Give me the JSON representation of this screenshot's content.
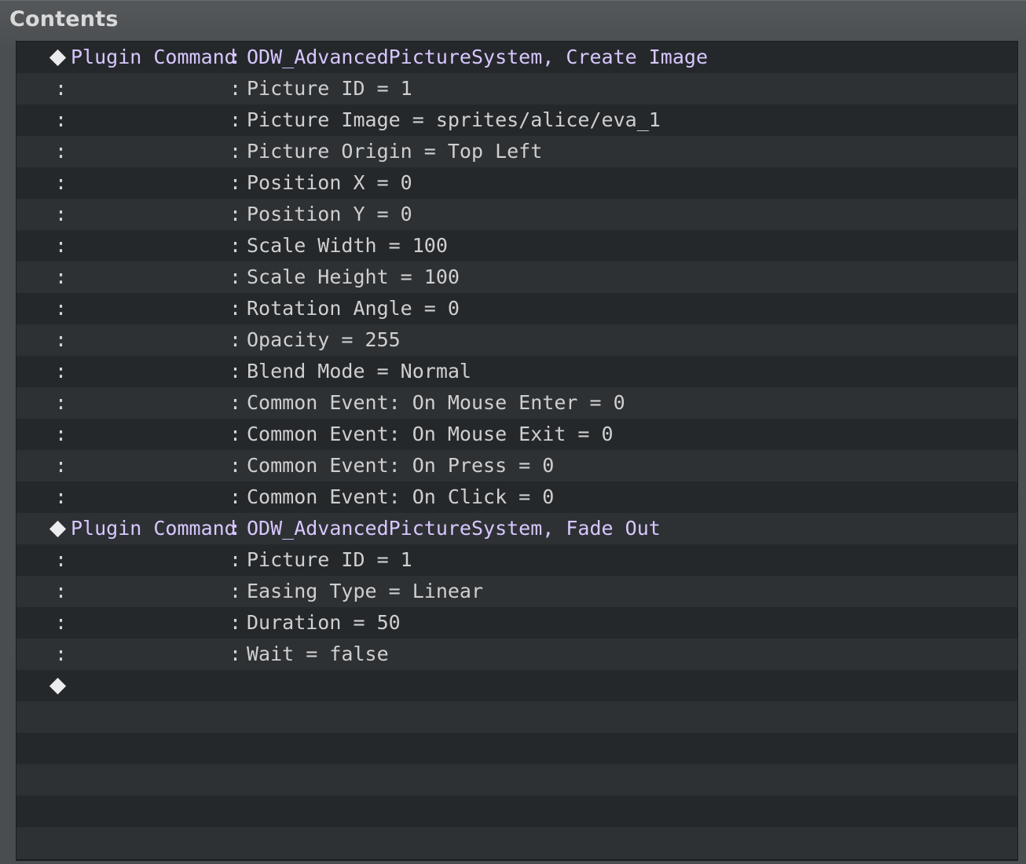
{
  "panel": {
    "title": "Contents"
  },
  "rows": [
    {
      "kind": "command",
      "label": "Plugin Command",
      "sep": ":",
      "text": "ODW_AdvancedPictureSystem, Create Image"
    },
    {
      "kind": "param",
      "lead": ":",
      "sep": ":",
      "text": "Picture ID = 1"
    },
    {
      "kind": "param",
      "lead": ":",
      "sep": ":",
      "text": "Picture Image = sprites/alice/eva_1"
    },
    {
      "kind": "param",
      "lead": ":",
      "sep": ":",
      "text": "Picture Origin = Top Left"
    },
    {
      "kind": "param",
      "lead": ":",
      "sep": ":",
      "text": "Position X = 0"
    },
    {
      "kind": "param",
      "lead": ":",
      "sep": ":",
      "text": "Position Y = 0"
    },
    {
      "kind": "param",
      "lead": ":",
      "sep": ":",
      "text": "Scale Width = 100"
    },
    {
      "kind": "param",
      "lead": ":",
      "sep": ":",
      "text": "Scale Height = 100"
    },
    {
      "kind": "param",
      "lead": ":",
      "sep": ":",
      "text": "Rotation Angle = 0"
    },
    {
      "kind": "param",
      "lead": ":",
      "sep": ":",
      "text": "Opacity = 255"
    },
    {
      "kind": "param",
      "lead": ":",
      "sep": ":",
      "text": "Blend Mode = Normal"
    },
    {
      "kind": "param",
      "lead": ":",
      "sep": ":",
      "text": "Common Event: On Mouse Enter = 0"
    },
    {
      "kind": "param",
      "lead": ":",
      "sep": ":",
      "text": "Common Event: On Mouse Exit = 0"
    },
    {
      "kind": "param",
      "lead": ":",
      "sep": ":",
      "text": "Common Event: On Press = 0"
    },
    {
      "kind": "param",
      "lead": ":",
      "sep": ":",
      "text": "Common Event: On Click = 0"
    },
    {
      "kind": "command",
      "label": "Plugin Command",
      "sep": ":",
      "text": "ODW_AdvancedPictureSystem, Fade Out"
    },
    {
      "kind": "param",
      "lead": ":",
      "sep": ":",
      "text": "Picture ID = 1"
    },
    {
      "kind": "param",
      "lead": ":",
      "sep": ":",
      "text": "Easing Type = Linear"
    },
    {
      "kind": "param",
      "lead": ":",
      "sep": ":",
      "text": "Duration = 50"
    },
    {
      "kind": "param",
      "lead": ":",
      "sep": ":",
      "text": "Wait = false"
    },
    {
      "kind": "empty"
    },
    {
      "kind": "blank"
    },
    {
      "kind": "blank"
    },
    {
      "kind": "blank"
    },
    {
      "kind": "blank"
    },
    {
      "kind": "blank"
    }
  ],
  "colors": {
    "command_text": "#d8c7ff",
    "param_text": "#cfcfcf",
    "row_dark": "#25282b",
    "row_light": "#2e3134"
  },
  "icons": {
    "command_marker": "diamond-icon"
  }
}
